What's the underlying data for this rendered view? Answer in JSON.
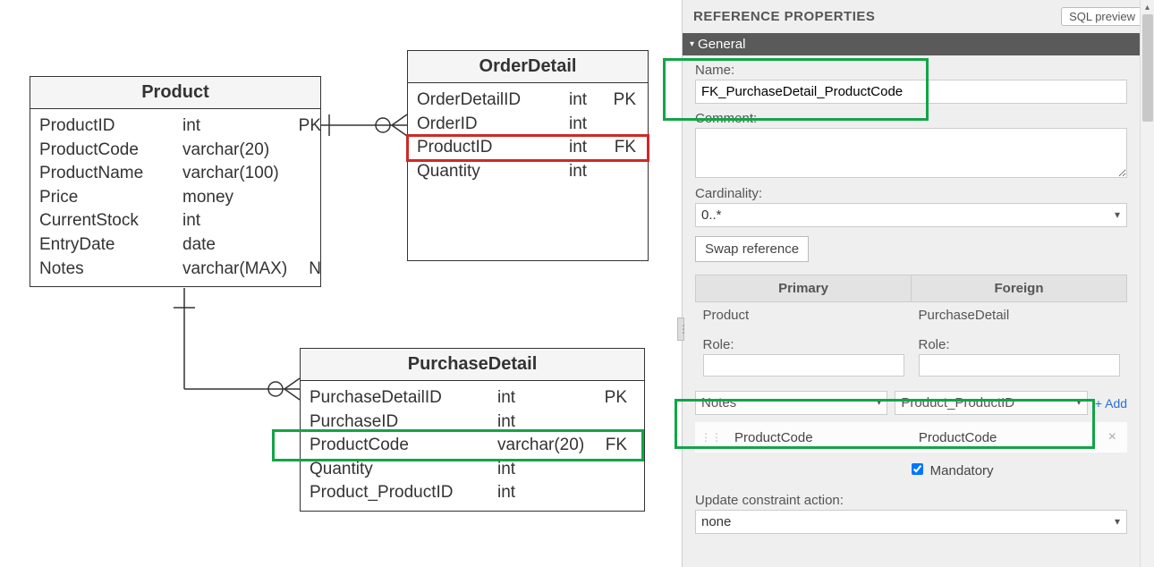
{
  "entities": {
    "product": {
      "title": "Product",
      "rows": [
        {
          "name": "ProductID",
          "type": "int",
          "key": "PK"
        },
        {
          "name": "ProductCode",
          "type": "varchar(20)",
          "key": ""
        },
        {
          "name": "ProductName",
          "type": "varchar(100)",
          "key": ""
        },
        {
          "name": "Price",
          "type": "money",
          "key": ""
        },
        {
          "name": "CurrentStock",
          "type": "int",
          "key": ""
        },
        {
          "name": "EntryDate",
          "type": "date",
          "key": ""
        },
        {
          "name": "Notes",
          "type": "varchar(MAX)",
          "key": "N"
        }
      ]
    },
    "order_detail": {
      "title": "OrderDetail",
      "rows": [
        {
          "name": "OrderDetailID",
          "type": "int",
          "key": "PK"
        },
        {
          "name": "OrderID",
          "type": "int",
          "key": ""
        },
        {
          "name": "ProductID",
          "type": "int",
          "key": "FK"
        },
        {
          "name": "Quantity",
          "type": "int",
          "key": ""
        }
      ]
    },
    "purchase_detail": {
      "title": "PurchaseDetail",
      "rows": [
        {
          "name": "PurchaseDetailID",
          "type": "int",
          "key": "PK"
        },
        {
          "name": "PurchaseID",
          "type": "int",
          "key": ""
        },
        {
          "name": "ProductCode",
          "type": "varchar(20)",
          "key": "FK"
        },
        {
          "name": "Quantity",
          "type": "int",
          "key": ""
        },
        {
          "name": "Product_ProductID",
          "type": "int",
          "key": ""
        }
      ]
    }
  },
  "panel": {
    "title": "REFERENCE PROPERTIES",
    "sql_preview": "SQL preview",
    "section_general": "General",
    "name_label": "Name:",
    "name_value": "FK_PurchaseDetail_ProductCode",
    "comment_label": "Comment:",
    "cardinality_label": "Cardinality:",
    "cardinality_value": "0..*",
    "swap_label": "Swap reference",
    "primary_header": "Primary",
    "foreign_header": "Foreign",
    "primary_entity": "Product",
    "foreign_entity": "PurchaseDetail",
    "role_label": "Role:",
    "primary_role": "",
    "foreign_role": "",
    "primary_dropdown": "Notes",
    "foreign_dropdown": "Product_ProductID",
    "add_link": "+ Add",
    "code_primary": "ProductCode",
    "code_foreign": "ProductCode",
    "mandatory_label": "Mandatory",
    "update_action_label": "Update constraint action:",
    "update_action_value": "none"
  }
}
